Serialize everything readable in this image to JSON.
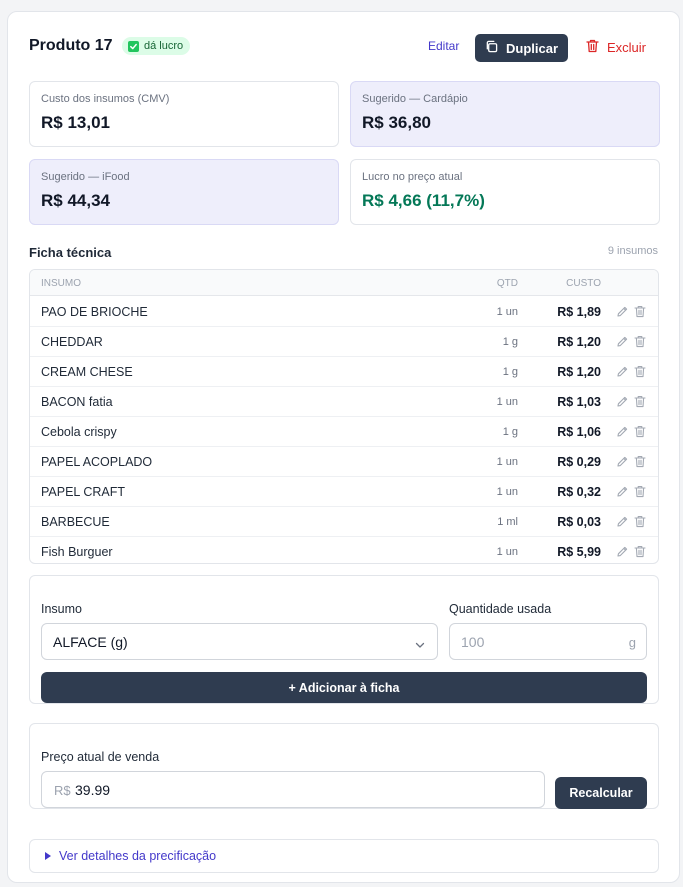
{
  "header": {
    "title": "Produto 17",
    "badge": "dá lucro",
    "edit_label": "Editar",
    "duplicate_label": "Duplicar",
    "delete_label": "Excluir"
  },
  "stats": {
    "cmv_label": "Custo dos insumos (CMV)",
    "cmv_value": "R$ 13,01",
    "cardapio_label": "Sugerido — Cardápio",
    "cardapio_value": "R$ 36,80",
    "ifood_label": "Sugerido — iFood",
    "ifood_value": "R$ 44,34",
    "profit_label": "Lucro no preço atual",
    "profit_value": "R$ 4,66 (11,7%)"
  },
  "ficha": {
    "title": "Ficha técnica",
    "count": "9 insumos",
    "columns": {
      "insumo": "INSUMO",
      "qtd": "QTD",
      "custo": "CUSTO"
    },
    "rows": [
      {
        "name": "PAO DE BRIOCHE",
        "qtd": "1 un",
        "cost": "R$ 1,89"
      },
      {
        "name": "CHEDDAR",
        "qtd": "1 g",
        "cost": "R$ 1,20"
      },
      {
        "name": "CREAM CHESE",
        "qtd": "1 g",
        "cost": "R$ 1,20"
      },
      {
        "name": "BACON fatia",
        "qtd": "1 un",
        "cost": "R$ 1,03"
      },
      {
        "name": "Cebola crispy",
        "qtd": "1 g",
        "cost": "R$ 1,06"
      },
      {
        "name": "PAPEL ACOPLADO",
        "qtd": "1 un",
        "cost": "R$ 0,29"
      },
      {
        "name": "PAPEL CRAFT",
        "qtd": "1 un",
        "cost": "R$ 0,32"
      },
      {
        "name": "BARBECUE",
        "qtd": "1 ml",
        "cost": "R$ 0,03"
      },
      {
        "name": "Fish Burguer",
        "qtd": "1 un",
        "cost": "R$ 5,99"
      }
    ]
  },
  "add_form": {
    "insumo_label": "Insumo",
    "insumo_value": "ALFACE (g)",
    "qty_label": "Quantidade usada",
    "qty_placeholder": "100",
    "qty_unit": "g",
    "add_button": "+ Adicionar à ficha"
  },
  "price": {
    "label": "Preço atual de venda",
    "prefix": "R$",
    "value": "39.99",
    "recalc_button": "Recalcular"
  },
  "details": {
    "label": "Ver detalhes da precificação"
  },
  "colors": {
    "primary_button": "#2f3c50",
    "accent": "#4338ca",
    "danger": "#dc2626",
    "profit_green": "#047857",
    "suggested_bg": "#eeeefb"
  }
}
